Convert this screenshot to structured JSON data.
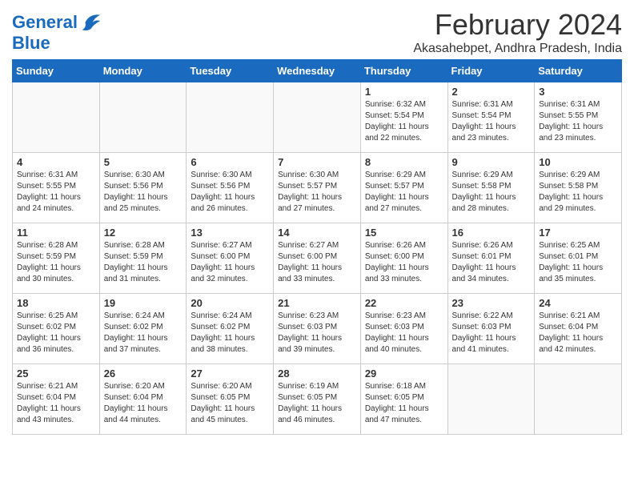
{
  "header": {
    "logo_line1": "General",
    "logo_line2": "Blue",
    "month_year": "February 2024",
    "location": "Akasahebpet, Andhra Pradesh, India"
  },
  "weekdays": [
    "Sunday",
    "Monday",
    "Tuesday",
    "Wednesday",
    "Thursday",
    "Friday",
    "Saturday"
  ],
  "weeks": [
    [
      {
        "day": "",
        "info": ""
      },
      {
        "day": "",
        "info": ""
      },
      {
        "day": "",
        "info": ""
      },
      {
        "day": "",
        "info": ""
      },
      {
        "day": "1",
        "info": "Sunrise: 6:32 AM\nSunset: 5:54 PM\nDaylight: 11 hours and 22 minutes."
      },
      {
        "day": "2",
        "info": "Sunrise: 6:31 AM\nSunset: 5:54 PM\nDaylight: 11 hours and 23 minutes."
      },
      {
        "day": "3",
        "info": "Sunrise: 6:31 AM\nSunset: 5:55 PM\nDaylight: 11 hours and 23 minutes."
      }
    ],
    [
      {
        "day": "4",
        "info": "Sunrise: 6:31 AM\nSunset: 5:55 PM\nDaylight: 11 hours and 24 minutes."
      },
      {
        "day": "5",
        "info": "Sunrise: 6:30 AM\nSunset: 5:56 PM\nDaylight: 11 hours and 25 minutes."
      },
      {
        "day": "6",
        "info": "Sunrise: 6:30 AM\nSunset: 5:56 PM\nDaylight: 11 hours and 26 minutes."
      },
      {
        "day": "7",
        "info": "Sunrise: 6:30 AM\nSunset: 5:57 PM\nDaylight: 11 hours and 27 minutes."
      },
      {
        "day": "8",
        "info": "Sunrise: 6:29 AM\nSunset: 5:57 PM\nDaylight: 11 hours and 27 minutes."
      },
      {
        "day": "9",
        "info": "Sunrise: 6:29 AM\nSunset: 5:58 PM\nDaylight: 11 hours and 28 minutes."
      },
      {
        "day": "10",
        "info": "Sunrise: 6:29 AM\nSunset: 5:58 PM\nDaylight: 11 hours and 29 minutes."
      }
    ],
    [
      {
        "day": "11",
        "info": "Sunrise: 6:28 AM\nSunset: 5:59 PM\nDaylight: 11 hours and 30 minutes."
      },
      {
        "day": "12",
        "info": "Sunrise: 6:28 AM\nSunset: 5:59 PM\nDaylight: 11 hours and 31 minutes."
      },
      {
        "day": "13",
        "info": "Sunrise: 6:27 AM\nSunset: 6:00 PM\nDaylight: 11 hours and 32 minutes."
      },
      {
        "day": "14",
        "info": "Sunrise: 6:27 AM\nSunset: 6:00 PM\nDaylight: 11 hours and 33 minutes."
      },
      {
        "day": "15",
        "info": "Sunrise: 6:26 AM\nSunset: 6:00 PM\nDaylight: 11 hours and 33 minutes."
      },
      {
        "day": "16",
        "info": "Sunrise: 6:26 AM\nSunset: 6:01 PM\nDaylight: 11 hours and 34 minutes."
      },
      {
        "day": "17",
        "info": "Sunrise: 6:25 AM\nSunset: 6:01 PM\nDaylight: 11 hours and 35 minutes."
      }
    ],
    [
      {
        "day": "18",
        "info": "Sunrise: 6:25 AM\nSunset: 6:02 PM\nDaylight: 11 hours and 36 minutes."
      },
      {
        "day": "19",
        "info": "Sunrise: 6:24 AM\nSunset: 6:02 PM\nDaylight: 11 hours and 37 minutes."
      },
      {
        "day": "20",
        "info": "Sunrise: 6:24 AM\nSunset: 6:02 PM\nDaylight: 11 hours and 38 minutes."
      },
      {
        "day": "21",
        "info": "Sunrise: 6:23 AM\nSunset: 6:03 PM\nDaylight: 11 hours and 39 minutes."
      },
      {
        "day": "22",
        "info": "Sunrise: 6:23 AM\nSunset: 6:03 PM\nDaylight: 11 hours and 40 minutes."
      },
      {
        "day": "23",
        "info": "Sunrise: 6:22 AM\nSunset: 6:03 PM\nDaylight: 11 hours and 41 minutes."
      },
      {
        "day": "24",
        "info": "Sunrise: 6:21 AM\nSunset: 6:04 PM\nDaylight: 11 hours and 42 minutes."
      }
    ],
    [
      {
        "day": "25",
        "info": "Sunrise: 6:21 AM\nSunset: 6:04 PM\nDaylight: 11 hours and 43 minutes."
      },
      {
        "day": "26",
        "info": "Sunrise: 6:20 AM\nSunset: 6:04 PM\nDaylight: 11 hours and 44 minutes."
      },
      {
        "day": "27",
        "info": "Sunrise: 6:20 AM\nSunset: 6:05 PM\nDaylight: 11 hours and 45 minutes."
      },
      {
        "day": "28",
        "info": "Sunrise: 6:19 AM\nSunset: 6:05 PM\nDaylight: 11 hours and 46 minutes."
      },
      {
        "day": "29",
        "info": "Sunrise: 6:18 AM\nSunset: 6:05 PM\nDaylight: 11 hours and 47 minutes."
      },
      {
        "day": "",
        "info": ""
      },
      {
        "day": "",
        "info": ""
      }
    ]
  ]
}
